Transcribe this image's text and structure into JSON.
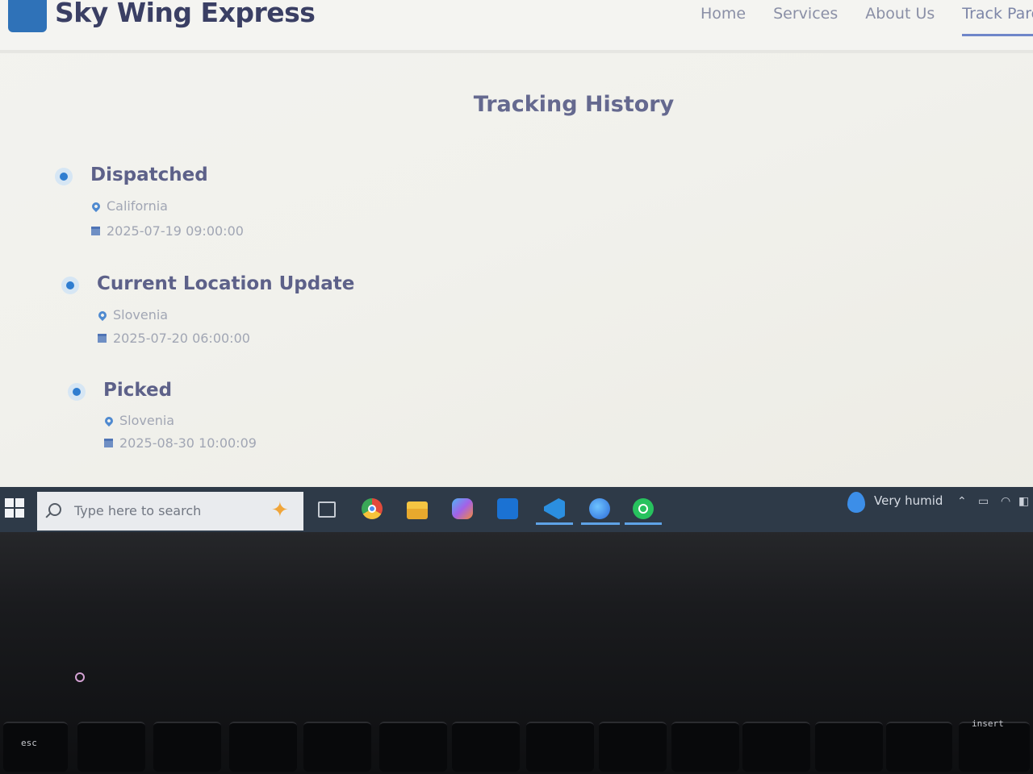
{
  "brand": {
    "name": "Sky Wing Express"
  },
  "nav": {
    "items": [
      "Home",
      "Services",
      "About Us",
      "Track Parce"
    ],
    "active_index": 3
  },
  "page": {
    "title": "Tracking History"
  },
  "events": [
    {
      "status": "Dispatched",
      "location": "California",
      "datetime": "2025-07-19 09:00:00"
    },
    {
      "status": "Current Location Update",
      "location": "Slovenia",
      "datetime": "2025-07-20 06:00:00"
    },
    {
      "status": "Picked",
      "location": "Slovenia",
      "datetime": "2025-08-30 10:00:09"
    }
  ],
  "taskbar": {
    "search_placeholder": "Type here to search",
    "apps": [
      "task-view",
      "chrome",
      "file-explorer",
      "copilot",
      "outlook",
      "vscode",
      "browser",
      "whatsapp"
    ],
    "weather": "Very humid"
  },
  "keyboard": {
    "esc_label": "esc",
    "insert_label": "insert"
  },
  "colors": {
    "accent": "#2f7dd0",
    "brand_logo": "#2f72b8",
    "taskbar": "#2e3a48"
  }
}
